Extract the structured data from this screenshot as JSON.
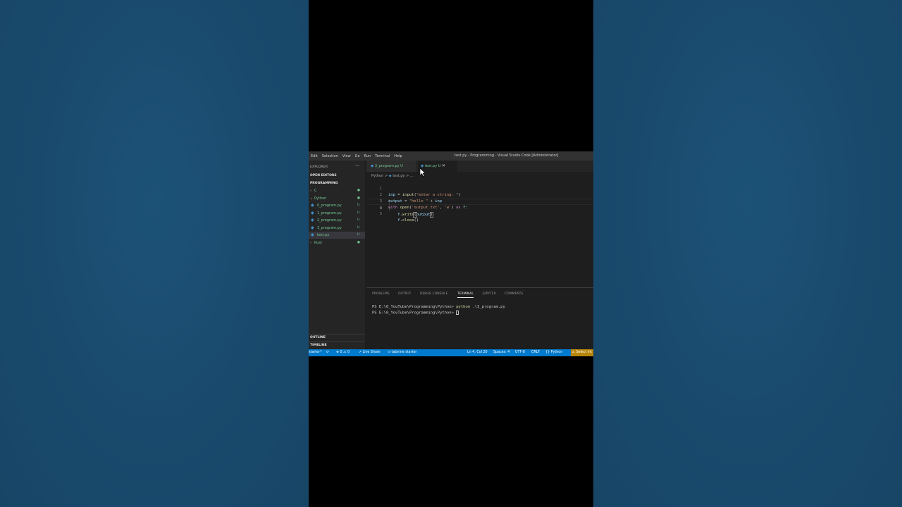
{
  "menu": [
    "Edit",
    "Selection",
    "View",
    "Go",
    "Run",
    "Terminal",
    "Help"
  ],
  "window_title": "test.py - Programming - Visual Studio Code [Administrator]",
  "sidebar": {
    "header": "EXPLORER",
    "more": "···",
    "open_editors": "OPEN EDITORS",
    "root": "PROGRAMMING",
    "tree": [
      {
        "label": "C",
        "type": "folder",
        "mark": "●"
      },
      {
        "label": "Python",
        "type": "folder-open",
        "mark": "●"
      },
      {
        "label": "0_program.py",
        "type": "file",
        "mark": "U"
      },
      {
        "label": "1_program.py",
        "type": "file",
        "mark": "U"
      },
      {
        "label": "2_program.py",
        "type": "file",
        "mark": "U"
      },
      {
        "label": "3_program.py",
        "type": "file",
        "mark": "U"
      },
      {
        "label": "test.py",
        "type": "file",
        "mark": "U",
        "active": true
      },
      {
        "label": "Rust",
        "type": "folder",
        "mark": "●"
      }
    ],
    "outline": "OUTLINE",
    "timeline": "TIMELINE"
  },
  "tabs": [
    {
      "label": "3_program.py",
      "status": "U",
      "active": false
    },
    {
      "label": "test.py",
      "status": "U",
      "active": true,
      "close": "✕"
    }
  ],
  "breadcrumb": {
    "folder": "Python",
    "sep": ">",
    "file": "test.py",
    "tail": "> ..."
  },
  "editor": {
    "line_numbers": [
      "1",
      "2",
      "3",
      "4",
      "5"
    ],
    "current_line": 4
  },
  "panel": {
    "tabs": [
      "PROBLEMS",
      "OUTPUT",
      "DEBUG CONSOLE",
      "TERMINAL",
      "JUPYTER",
      "COMMENTS"
    ],
    "active_tab": "TERMINAL",
    "terminal": {
      "prompt": "PS E:\\0_YouTube\\Programming\\Python>",
      "command": "python",
      "argument": ".\\3_program.py"
    }
  },
  "statusbar": {
    "branch": "starter*",
    "sync_icon": "⟳",
    "problems": "⊗ 0 ⚠ 0",
    "live_share": "Live Share",
    "tabnine": "⊙ tabnine starter",
    "position": "Ln 4, Col 20",
    "spaces": "Spaces: 4",
    "encoding": "UTF-8",
    "eol": "CRLF",
    "language": "Python",
    "warning": "⚠ Select Int"
  },
  "colors": {
    "accent": "#007acc",
    "git_untracked": "#73c991",
    "warning": "#b8860b"
  }
}
